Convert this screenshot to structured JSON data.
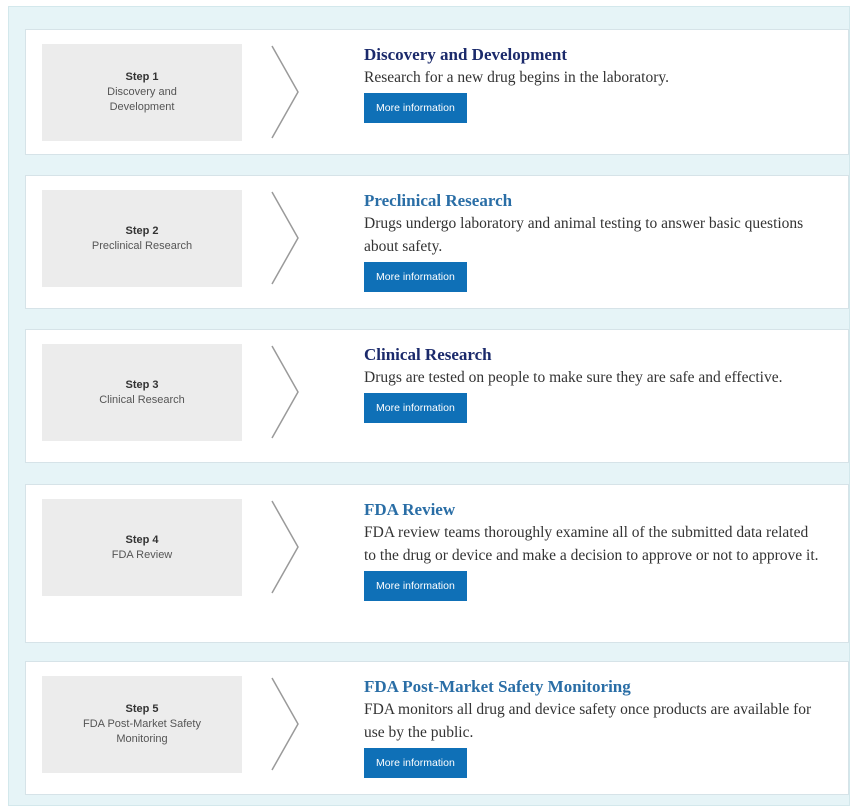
{
  "button_label": "More information",
  "steps": [
    {
      "step": "Step 1",
      "label": "Discovery and Development",
      "title": "Discovery and Development",
      "description": "Research for a new drug begins in the laboratory."
    },
    {
      "step": "Step 2",
      "label": "Preclinical Research",
      "title": "Preclinical Research",
      "description": "Drugs undergo laboratory and animal testing to answer basic questions about safety."
    },
    {
      "step": "Step 3",
      "label": "Clinical Research",
      "title": "Clinical Research",
      "description": "Drugs are tested on people to make sure they are safe and effective."
    },
    {
      "step": "Step 4",
      "label": "FDA Review",
      "title": "FDA Review",
      "description": "FDA review teams thoroughly examine all of the submitted data related to the drug or device and make a decision to approve or not to approve it."
    },
    {
      "step": "Step 5",
      "label": "FDA Post-Market Safety Monitoring",
      "title": "FDA Post-Market Safety Monitoring",
      "description": "FDA monitors all drug and device safety once products are available for use by the public."
    }
  ],
  "colors": {
    "button": "#0f70b7",
    "title_dark": "#1b2a6b",
    "title_light": "#2a6ea6",
    "frame_bg": "#e6f4f7"
  }
}
